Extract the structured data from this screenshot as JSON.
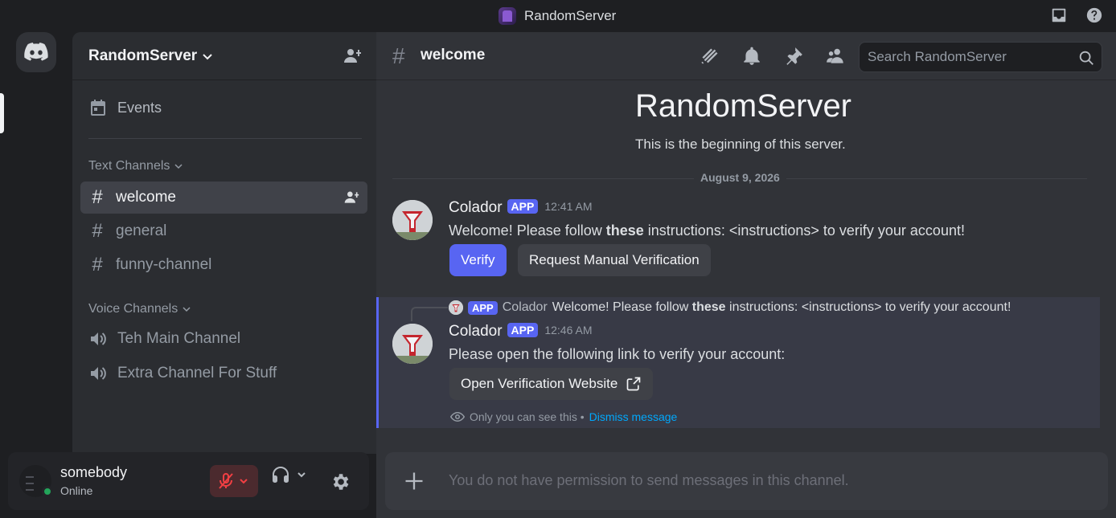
{
  "titlebar": {
    "server_name": "RandomServer"
  },
  "server": {
    "name": "RandomServer"
  },
  "sidebar": {
    "events_label": "Events",
    "text_category": "Text Channels",
    "voice_category": "Voice Channels",
    "text_channels": [
      {
        "name": "welcome",
        "active": true
      },
      {
        "name": "general",
        "active": false
      },
      {
        "name": "funny-channel",
        "active": false
      }
    ],
    "voice_channels": [
      {
        "name": "Teh Main Channel"
      },
      {
        "name": "Extra Channel For Stuff"
      }
    ]
  },
  "user": {
    "name": "somebody",
    "status": "Online"
  },
  "channel": {
    "name": "welcome",
    "search_placeholder": "Search RandomServer"
  },
  "welcome": {
    "title": "RandomServer",
    "subtitle": "This is the beginning of this server."
  },
  "date_separator": "August 9, 2026",
  "messages": [
    {
      "author": "Colador",
      "tag": "APP",
      "time": "12:41 AM",
      "text_before": "Welcome! Please follow ",
      "text_bold": "these",
      "text_after": " instructions: <instructions> to verify your account!",
      "buttons": {
        "verify": "Verify",
        "manual": "Request Manual Verification"
      }
    },
    {
      "author": "Colador",
      "tag": "APP",
      "time": "12:46 AM",
      "reply": {
        "tag": "APP",
        "author": "Colador",
        "text_before": "Welcome! Please follow ",
        "text_bold": "these",
        "text_after": " instructions: <instructions> to verify your account!"
      },
      "text": "Please open the following link to verify your account:",
      "link_button": "Open Verification Website",
      "ephemeral_note": "Only you can see this •",
      "dismiss": "Dismiss message"
    }
  ],
  "composer": {
    "placeholder": "You do not have permission to send messages in this channel."
  },
  "colors": {
    "accent": "#5865f2",
    "online": "#23a55a",
    "link": "#00a8fc",
    "mute": "#f23f43"
  }
}
